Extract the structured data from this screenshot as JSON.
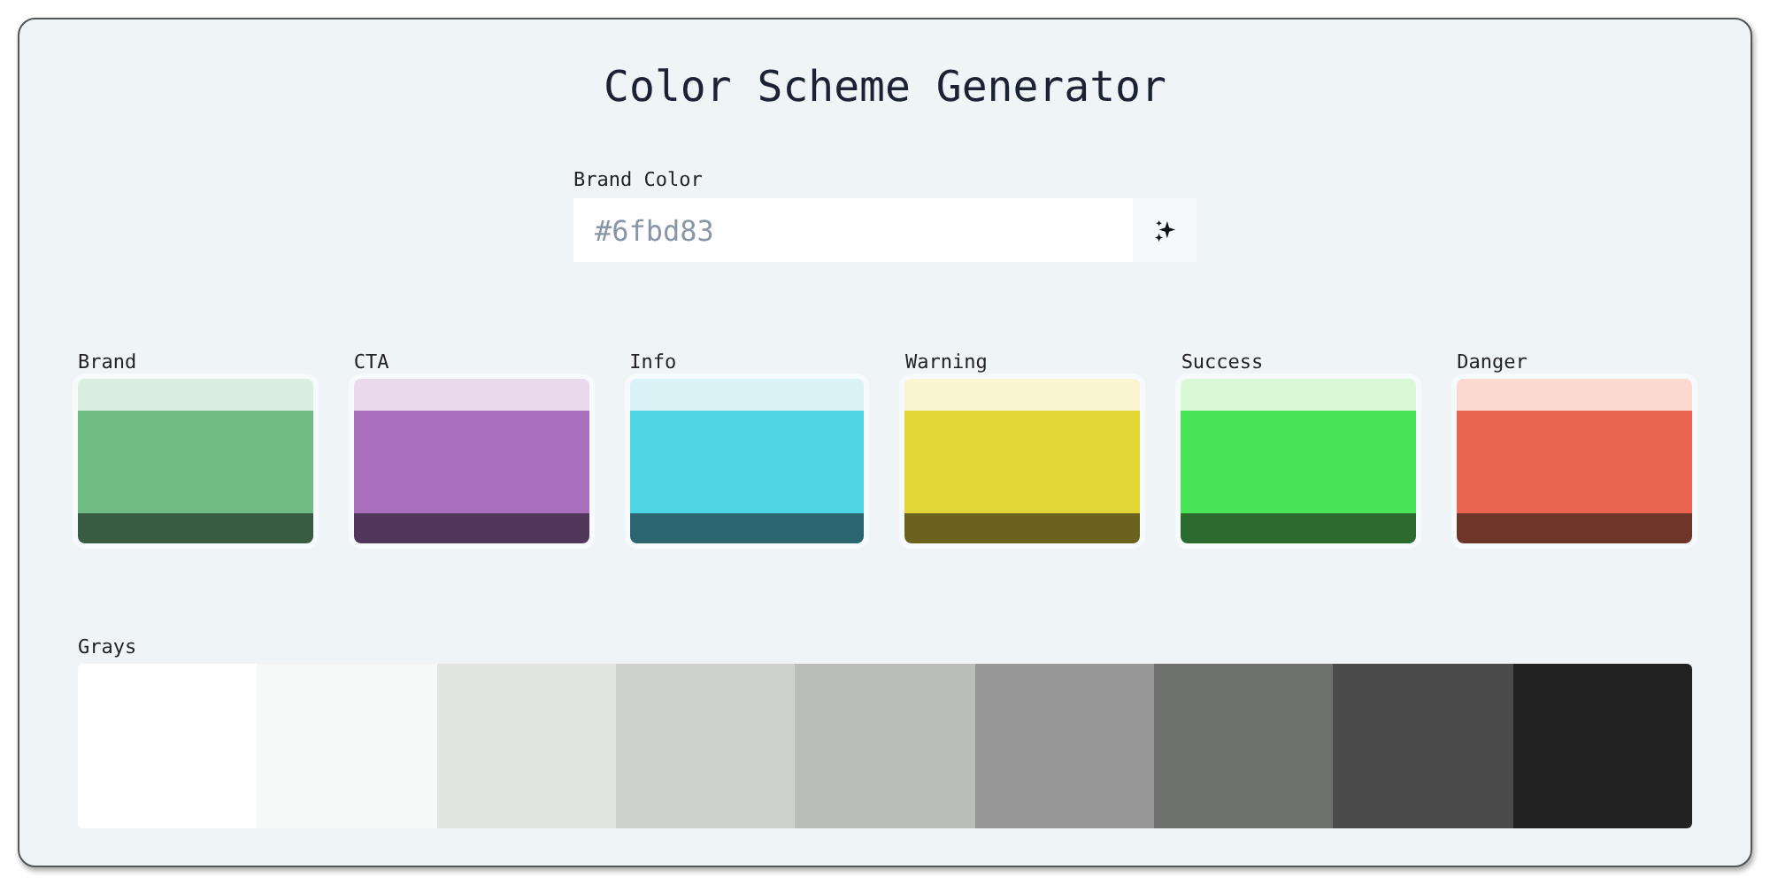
{
  "title": "Color Scheme Generator",
  "brand_field": {
    "label": "Brand Color",
    "placeholder": "#6fbd83"
  },
  "swatches": [
    {
      "label": "Brand",
      "shades": [
        {
          "color": "#dbefe0"
        },
        {
          "color": "#6fbd83"
        },
        {
          "color": "#375c41"
        }
      ]
    },
    {
      "label": "CTA",
      "shades": [
        {
          "color": "#ead9ed"
        },
        {
          "color": "#a86fbd"
        },
        {
          "color": "#52375c"
        }
      ]
    },
    {
      "label": "Info",
      "shades": [
        {
          "color": "#d9f3f7"
        },
        {
          "color": "#4fd6e3"
        },
        {
          "color": "#2b6670"
        }
      ]
    },
    {
      "label": "Warning",
      "shades": [
        {
          "color": "#fbf4d0"
        },
        {
          "color": "#e3d634"
        },
        {
          "color": "#6b6220"
        }
      ]
    },
    {
      "label": "Success",
      "shades": [
        {
          "color": "#d9f9d6"
        },
        {
          "color": "#49e457"
        },
        {
          "color": "#2b6b2e"
        }
      ]
    },
    {
      "label": "Danger",
      "shades": [
        {
          "color": "#fbd9d0"
        },
        {
          "color": "#ea634e"
        },
        {
          "color": "#6e352b"
        }
      ]
    }
  ],
  "grays": {
    "label": "Grays",
    "cells": [
      {
        "color": "#ffffff"
      },
      {
        "color": "#f7f8f8"
      },
      {
        "color": "#e2e4e2"
      },
      {
        "color": "#cfd1cf"
      },
      {
        "color": "#bbbdba"
      },
      {
        "color": "#979797"
      },
      {
        "color": "#6e706d"
      },
      {
        "color": "#4a4b4a"
      },
      {
        "color": "#222222"
      }
    ]
  }
}
